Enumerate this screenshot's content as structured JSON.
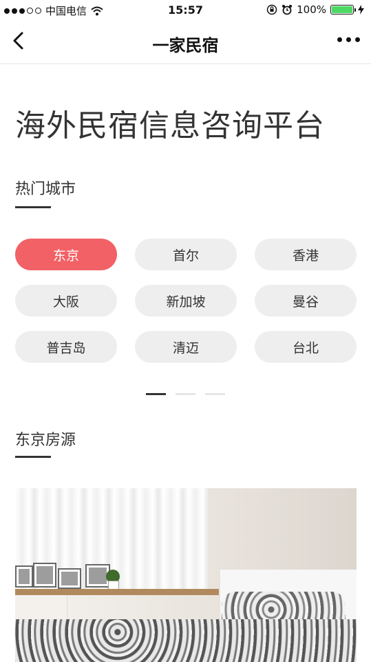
{
  "status_bar": {
    "carrier": "中国电信",
    "time": "15:57",
    "battery": "100%",
    "battery_level": 1.0,
    "battery_color": "#4cd964"
  },
  "nav": {
    "title": "一家民宿",
    "back_icon": "chevron-left-icon",
    "more_icon": "ellipsis-icon"
  },
  "hero": {
    "title": "海外民宿信息咨询平台"
  },
  "hot_cities": {
    "title": "热门城市",
    "accent_color": "#f26165",
    "items": [
      {
        "label": "东京",
        "selected": true
      },
      {
        "label": "首尔",
        "selected": false
      },
      {
        "label": "香港",
        "selected": false
      },
      {
        "label": "大阪",
        "selected": false
      },
      {
        "label": "新加坡",
        "selected": false
      },
      {
        "label": "曼谷",
        "selected": false
      },
      {
        "label": "普吉岛",
        "selected": false
      },
      {
        "label": "清迈",
        "selected": false
      },
      {
        "label": "台北",
        "selected": false
      }
    ],
    "pager": {
      "pages": 3,
      "current": 1
    }
  },
  "listings": {
    "title": "东京房源"
  }
}
